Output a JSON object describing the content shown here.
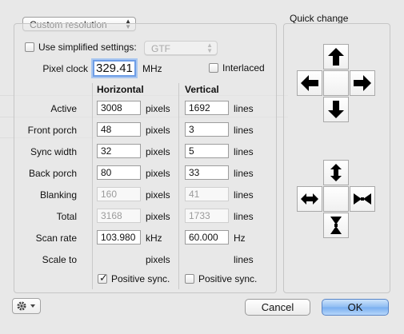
{
  "resolution_popup": {
    "value": "Custom resolution"
  },
  "simplified": {
    "label": "Use simplified settings:",
    "checked": false,
    "popup_value": "GTF"
  },
  "pixel_clock": {
    "label": "Pixel clock",
    "value": "329.41",
    "unit": "MHz"
  },
  "interlaced": {
    "label": "Interlaced",
    "checked": false
  },
  "columns": {
    "horizontal": "Horizontal",
    "vertical": "Vertical"
  },
  "rows": [
    {
      "label": "Active",
      "h_value": "3008",
      "h_unit": "pixels",
      "v_value": "1692",
      "v_unit": "lines",
      "editable": true
    },
    {
      "label": "Front porch",
      "h_value": "48",
      "h_unit": "pixels",
      "v_value": "3",
      "v_unit": "lines",
      "editable": true
    },
    {
      "label": "Sync width",
      "h_value": "32",
      "h_unit": "pixels",
      "v_value": "5",
      "v_unit": "lines",
      "editable": true
    },
    {
      "label": "Back porch",
      "h_value": "80",
      "h_unit": "pixels",
      "v_value": "33",
      "v_unit": "lines",
      "editable": true
    },
    {
      "label": "Blanking",
      "h_value": "160",
      "h_unit": "pixels",
      "v_value": "41",
      "v_unit": "lines",
      "editable": false
    },
    {
      "label": "Total",
      "h_value": "3168",
      "h_unit": "pixels",
      "v_value": "1733",
      "v_unit": "lines",
      "editable": false
    },
    {
      "label": "Scan rate",
      "h_value": "103.980",
      "h_unit": "kHz",
      "v_value": "60.000",
      "v_unit": "Hz",
      "editable": true
    },
    {
      "label": "Scale to",
      "h_unit": "pixels",
      "v_unit": "lines"
    }
  ],
  "positive_sync": {
    "horizontal": {
      "label": "Positive sync.",
      "checked": true
    },
    "vertical": {
      "label": "Positive sync.",
      "checked": false
    }
  },
  "quick_change": {
    "title": "Quick change",
    "icons": [
      "arrow-up-icon",
      "arrow-left-icon",
      "arrow-right-icon",
      "arrow-down-icon",
      "expand-vertical-icon",
      "expand-horizontal-icon",
      "shrink-horizontal-icon",
      "shrink-vertical-icon"
    ]
  },
  "buttons": {
    "cancel": "Cancel",
    "ok": "OK",
    "gear_icon": "gear-icon"
  },
  "colors": {
    "default_button": "#79aef0",
    "focus_ring": "#6f9ee6"
  }
}
